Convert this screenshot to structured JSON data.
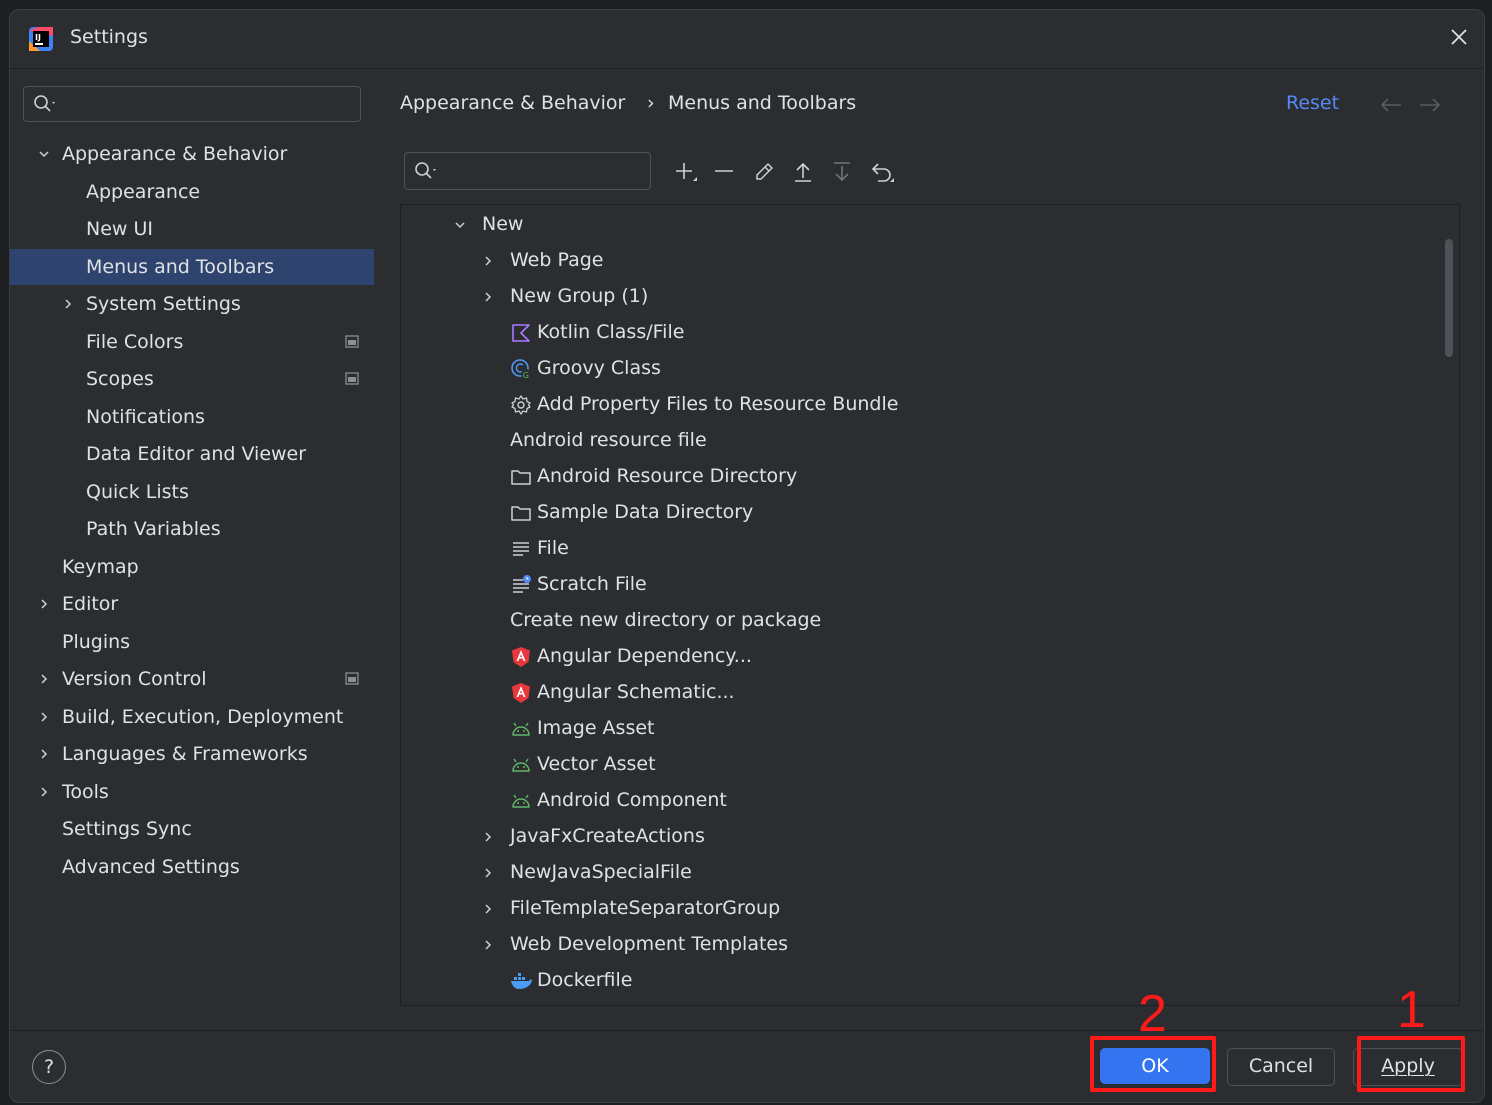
{
  "window": {
    "title": "Settings"
  },
  "sidebar": {
    "search_placeholder": "",
    "items": [
      {
        "label": "Appearance & Behavior",
        "level": 0,
        "expanded": true
      },
      {
        "label": "Appearance",
        "level": 1
      },
      {
        "label": "New UI",
        "level": 1
      },
      {
        "label": "Menus and Toolbars",
        "level": 1,
        "selected": true
      },
      {
        "label": "System Settings",
        "level": 1,
        "expandable": true
      },
      {
        "label": "File Colors",
        "level": 1,
        "project_icon": true
      },
      {
        "label": "Scopes",
        "level": 1,
        "project_icon": true
      },
      {
        "label": "Notifications",
        "level": 1
      },
      {
        "label": "Data Editor and Viewer",
        "level": 1
      },
      {
        "label": "Quick Lists",
        "level": 1
      },
      {
        "label": "Path Variables",
        "level": 1
      },
      {
        "label": "Keymap",
        "level": 0
      },
      {
        "label": "Editor",
        "level": 0,
        "expandable": true
      },
      {
        "label": "Plugins",
        "level": 0
      },
      {
        "label": "Version Control",
        "level": 0,
        "expandable": true,
        "project_icon": true
      },
      {
        "label": "Build, Execution, Deployment",
        "level": 0,
        "expandable": true
      },
      {
        "label": "Languages & Frameworks",
        "level": 0,
        "expandable": true
      },
      {
        "label": "Tools",
        "level": 0,
        "expandable": true
      },
      {
        "label": "Settings Sync",
        "level": 0
      },
      {
        "label": "Advanced Settings",
        "level": 0
      }
    ]
  },
  "breadcrumb": {
    "parent": "Appearance & Behavior",
    "separator": "›",
    "current": "Menus and Toolbars"
  },
  "header": {
    "reset_label": "Reset"
  },
  "toolbar": {
    "search_placeholder": "",
    "buttons": [
      "add-icon",
      "remove-icon",
      "edit-icon",
      "move-up-icon",
      "move-down-icon",
      "restore-icon"
    ]
  },
  "actions_tree": [
    {
      "label": "New",
      "depth": 0,
      "chevron": "down",
      "icon": "none"
    },
    {
      "label": "Web Page",
      "depth": 1,
      "chevron": "right",
      "icon": "none"
    },
    {
      "label": "New Group (1)",
      "depth": 1,
      "chevron": "right",
      "icon": "none"
    },
    {
      "label": "Kotlin Class/File",
      "depth": 1,
      "icon": "kotlin-icon"
    },
    {
      "label": "Groovy Class",
      "depth": 1,
      "icon": "groovy-icon"
    },
    {
      "label": "Add Property Files to Resource Bundle",
      "depth": 1,
      "icon": "gear-icon"
    },
    {
      "label": "Android resource file",
      "depth": 1,
      "icon": "none"
    },
    {
      "label": "Android Resource Directory",
      "depth": 1,
      "icon": "folder-icon"
    },
    {
      "label": "Sample Data Directory",
      "depth": 1,
      "icon": "folder-icon"
    },
    {
      "label": "File",
      "depth": 1,
      "icon": "file-text-icon"
    },
    {
      "label": "Scratch File",
      "depth": 1,
      "icon": "scratch-file-icon"
    },
    {
      "label": "Create new directory or package",
      "depth": 1,
      "icon": "none"
    },
    {
      "label": "Angular Dependency...",
      "depth": 1,
      "icon": "angular-icon"
    },
    {
      "label": "Angular Schematic...",
      "depth": 1,
      "icon": "angular-icon"
    },
    {
      "label": "Image Asset",
      "depth": 1,
      "icon": "android-icon"
    },
    {
      "label": "Vector Asset",
      "depth": 1,
      "icon": "android-icon"
    },
    {
      "label": "Android Component",
      "depth": 1,
      "icon": "android-icon"
    },
    {
      "label": "JavaFxCreateActions",
      "depth": 1,
      "chevron": "right",
      "icon": "none"
    },
    {
      "label": "NewJavaSpecialFile",
      "depth": 1,
      "chevron": "right",
      "icon": "none"
    },
    {
      "label": "FileTemplateSeparatorGroup",
      "depth": 1,
      "chevron": "right",
      "icon": "none"
    },
    {
      "label": "Web Development Templates",
      "depth": 1,
      "chevron": "right",
      "icon": "none"
    },
    {
      "label": "Dockerfile",
      "depth": 1,
      "icon": "docker-icon"
    }
  ],
  "footer": {
    "help_label": "?",
    "ok_label": "OK",
    "cancel_label": "Cancel",
    "apply_label": "Apply"
  },
  "annotations": [
    {
      "label": "2",
      "target": "ok-button"
    },
    {
      "label": "1",
      "target": "apply-button"
    }
  ],
  "colors": {
    "accent": "#3574f0",
    "selection": "#2e436e",
    "annotation": "#ff1a1a",
    "link": "#548af7"
  }
}
